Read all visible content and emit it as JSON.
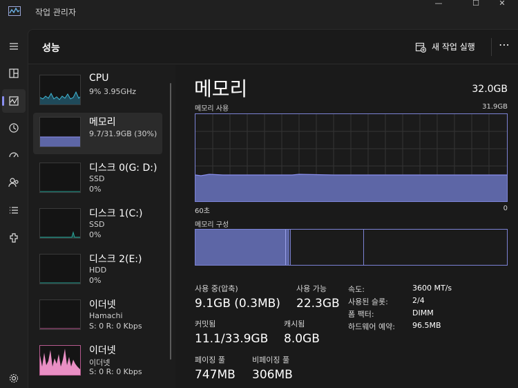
{
  "window": {
    "title": "작업 관리자"
  },
  "colors": {
    "accent": "#8a8ff0",
    "memory_fill": "#5d66a6",
    "cpu_line": "#3fb8d6",
    "disk_line": "#2aa69a",
    "ethernet_fill": "#e98fc4",
    "ethernet_line": "#b75a8f"
  },
  "header": {
    "title": "성능",
    "run_task_label": "새 작업 실행"
  },
  "nav_icons": [
    "hamburger-icon",
    "processes-icon",
    "performance-icon",
    "history-icon",
    "startup-icon",
    "users-icon",
    "details-icon",
    "services-icon",
    "settings-icon"
  ],
  "sidebar": {
    "items": [
      {
        "name": "CPU",
        "sub1": "9% 3.95GHz"
      },
      {
        "name": "메모리",
        "sub1": "9.7/31.9GB (30%)"
      },
      {
        "name": "디스크 0(G: D:)",
        "sub1": "SSD",
        "sub2": "0%"
      },
      {
        "name": "디스크 1(C:)",
        "sub1": "SSD",
        "sub2": "0%"
      },
      {
        "name": "디스크 2(E:)",
        "sub1": "HDD",
        "sub2": "0%"
      },
      {
        "name": "이더넷",
        "sub1": "Hamachi",
        "sub2": "S: 0 R: 0 Kbps"
      },
      {
        "name": "이더넷",
        "sub1": "이더넷",
        "sub2": "S: 0 R: 0 Kbps"
      }
    ]
  },
  "detail": {
    "title": "메모리",
    "total": "32.0GB",
    "usage_label": "메모리 사용",
    "usage_max": "31.9GB",
    "time_left": "60초",
    "time_right": "0",
    "composition_label": "메모리 구성",
    "usage_level_fraction": 0.3,
    "stats": {
      "in_use_label": "사용 중(압축)",
      "in_use_value": "9.1GB (0.3MB)",
      "available_label": "사용 가능",
      "available_value": "22.3GB",
      "committed_label": "커밋됨",
      "committed_value": "11.1/33.9GB",
      "cached_label": "캐시됨",
      "cached_value": "8.0GB",
      "paged_label": "페이징 풀",
      "paged_value": "747MB",
      "nonpaged_label": "비페이징 풀",
      "nonpaged_value": "306MB"
    },
    "specs": [
      {
        "key": "속도:",
        "value": "3600 MT/s"
      },
      {
        "key": "사용된 슬롯:",
        "value": "2/4"
      },
      {
        "key": "폼 팩터:",
        "value": "DIMM"
      },
      {
        "key": "하드웨어 예약:",
        "value": "96.5MB"
      }
    ]
  }
}
